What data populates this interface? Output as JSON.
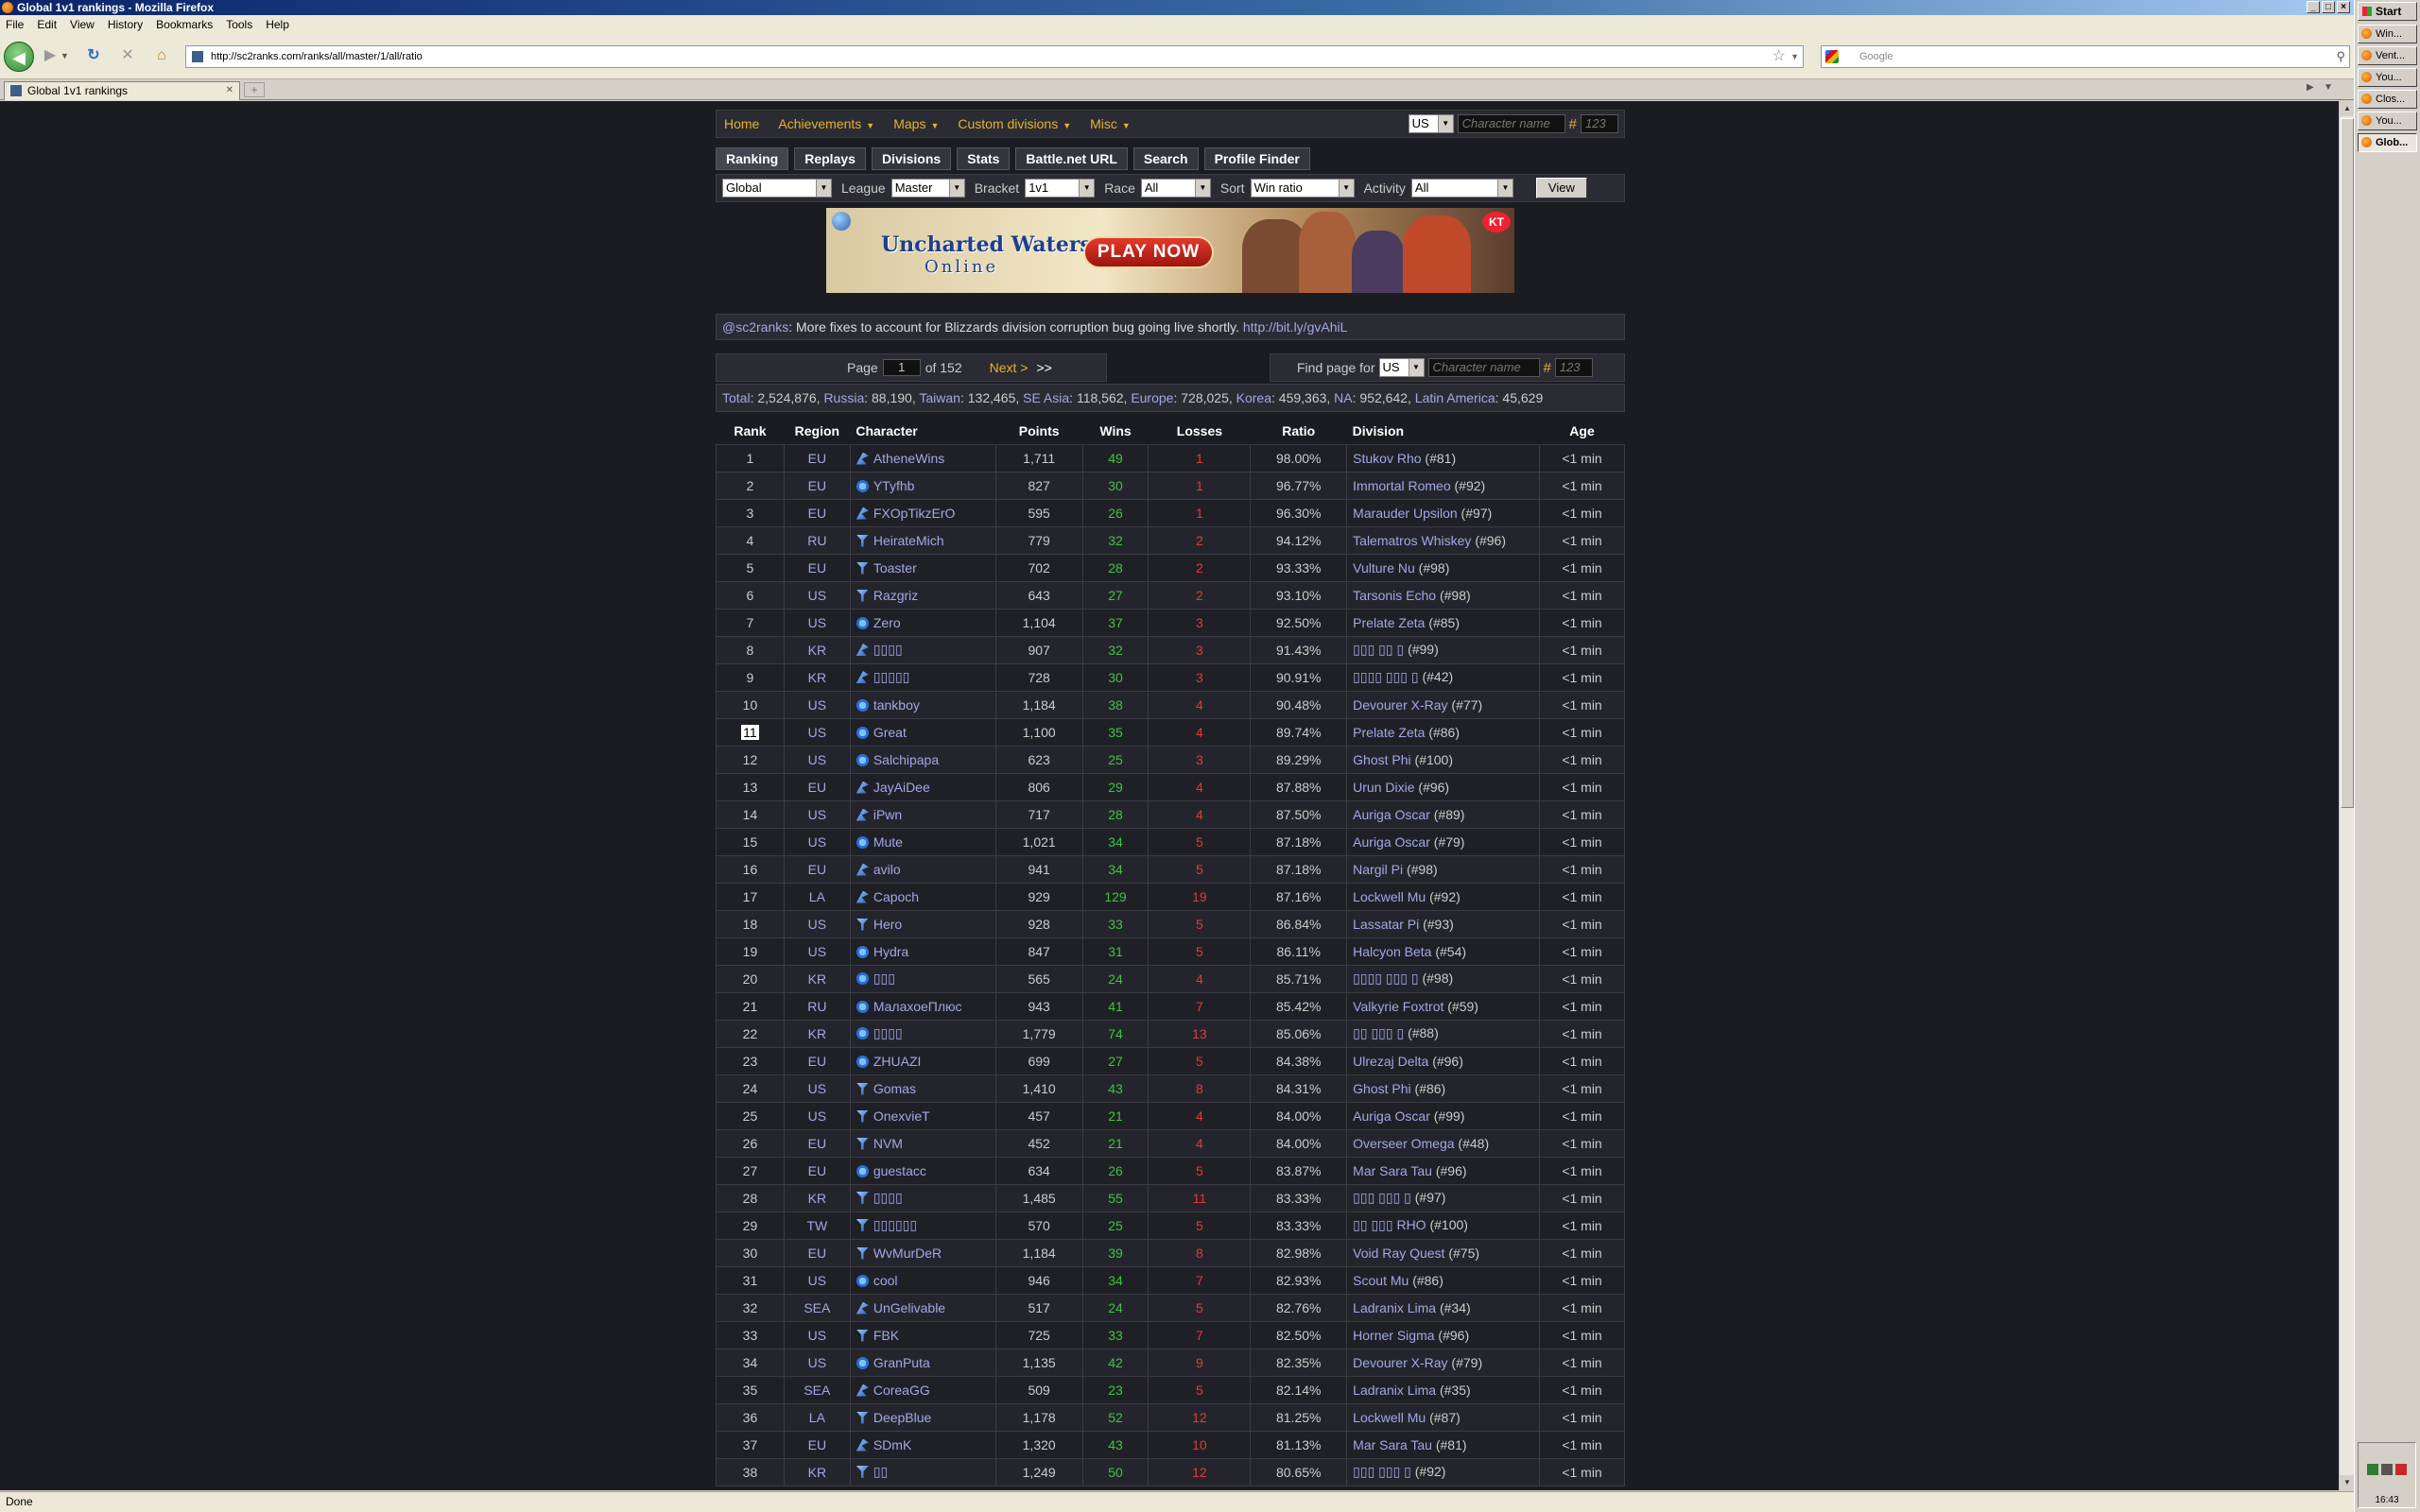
{
  "window": {
    "title": "Global 1v1 rankings - Mozilla Firefox",
    "menu": [
      "File",
      "Edit",
      "View",
      "History",
      "Bookmarks",
      "Tools",
      "Help"
    ],
    "url": "http://sc2ranks.com/ranks/all/master/1/all/ratio",
    "search_placeholder": "Google",
    "tab_title": "Global 1v1 rankings",
    "status": "Done"
  },
  "taskbar": {
    "start": "Start",
    "items": [
      "Win...",
      "Vent...",
      "You...",
      "Clos...",
      "You...",
      "Glob..."
    ],
    "clock": "16:43"
  },
  "nav": {
    "items": [
      {
        "label": "Home",
        "dropdown": false
      },
      {
        "label": "Achievements",
        "dropdown": true
      },
      {
        "label": "Maps",
        "dropdown": true
      },
      {
        "label": "Custom divisions",
        "dropdown": true
      },
      {
        "label": "Misc",
        "dropdown": true
      }
    ],
    "region": "US",
    "char_placeholder": "Character name",
    "code_placeholder": "123"
  },
  "tabs": [
    "Ranking",
    "Replays",
    "Divisions",
    "Stats",
    "Battle.net URL",
    "Search",
    "Profile Finder"
  ],
  "filters": {
    "region": "Global",
    "league_label": "League",
    "league": "Master",
    "bracket_label": "Bracket",
    "bracket": "1v1",
    "race_label": "Race",
    "race": "All",
    "sort_label": "Sort",
    "sort": "Win ratio",
    "activity_label": "Activity",
    "activity": "All",
    "view_button": "View"
  },
  "banner": {
    "title_line1": "Uncharted Waters",
    "title_line2": "Online",
    "cta": "PLAY NOW",
    "badge": "KT"
  },
  "news": {
    "handle": "@sc2ranks",
    "text": ": More fixes to account for Blizzards division corruption bug going live shortly.",
    "link": "http://bit.ly/gvAhiL"
  },
  "pager": {
    "page_label": "Page",
    "page": "1",
    "of_label": "of 152",
    "next": "Next >",
    "last": ">>",
    "find_label": "Find page for",
    "find_region": "US",
    "char_placeholder": "Character name",
    "code_placeholder": "123"
  },
  "totals": [
    {
      "label": "Total",
      "value": "2,524,876"
    },
    {
      "label": "Russia",
      "value": "88,190"
    },
    {
      "label": "Taiwan",
      "value": "132,465"
    },
    {
      "label": "SE Asia",
      "value": "118,562"
    },
    {
      "label": "Europe",
      "value": "728,025"
    },
    {
      "label": "Korea",
      "value": "459,363"
    },
    {
      "label": "NA",
      "value": "952,642"
    },
    {
      "label": "Latin America",
      "value": "45,629"
    }
  ],
  "table": {
    "headers": [
      "Rank",
      "Region",
      "Character",
      "Points",
      "Wins",
      "Losses",
      "Ratio",
      "Division",
      "Age"
    ],
    "rows": [
      {
        "rank": "1",
        "region": "EU",
        "race": "z",
        "name": "AtheneWins",
        "points": "1,711",
        "wins": "49",
        "losses": "1",
        "ratio": "98.00%",
        "division": "Stukov Rho",
        "div_num": "(#81)",
        "age": "<1 min"
      },
      {
        "rank": "2",
        "region": "EU",
        "race": "p",
        "name": "YTyfhb",
        "points": "827",
        "wins": "30",
        "losses": "1",
        "ratio": "96.77%",
        "division": "Immortal Romeo",
        "div_num": "(#92)",
        "age": "<1 min"
      },
      {
        "rank": "3",
        "region": "EU",
        "race": "z",
        "name": "FXOpTikzErO",
        "points": "595",
        "wins": "26",
        "losses": "1",
        "ratio": "96.30%",
        "division": "Marauder Upsilon",
        "div_num": "(#97)",
        "age": "<1 min"
      },
      {
        "rank": "4",
        "region": "RU",
        "race": "t",
        "name": "HeirateMich",
        "points": "779",
        "wins": "32",
        "losses": "2",
        "ratio": "94.12%",
        "division": "Talematros Whiskey",
        "div_num": "(#96)",
        "age": "<1 min"
      },
      {
        "rank": "5",
        "region": "EU",
        "race": "t",
        "name": "Toaster",
        "points": "702",
        "wins": "28",
        "losses": "2",
        "ratio": "93.33%",
        "division": "Vulture Nu",
        "div_num": "(#98)",
        "age": "<1 min"
      },
      {
        "rank": "6",
        "region": "US",
        "race": "t",
        "name": "Razgriz",
        "points": "643",
        "wins": "27",
        "losses": "2",
        "ratio": "93.10%",
        "division": "Tarsonis Echo",
        "div_num": "(#98)",
        "age": "<1 min"
      },
      {
        "rank": "7",
        "region": "US",
        "race": "p",
        "name": "Zero",
        "points": "1,104",
        "wins": "37",
        "losses": "3",
        "ratio": "92.50%",
        "division": "Prelate Zeta",
        "div_num": "(#85)",
        "age": "<1 min"
      },
      {
        "rank": "8",
        "region": "KR",
        "race": "z",
        "name": "▯▯▯▯",
        "points": "907",
        "wins": "32",
        "losses": "3",
        "ratio": "91.43%",
        "division": "▯▯▯ ▯▯ ▯",
        "div_num": "(#99)",
        "age": "<1 min"
      },
      {
        "rank": "9",
        "region": "KR",
        "race": "z",
        "name": "▯▯▯▯▯",
        "points": "728",
        "wins": "30",
        "losses": "3",
        "ratio": "90.91%",
        "division": "▯▯▯▯ ▯▯▯ ▯",
        "div_num": "(#42)",
        "age": "<1 min"
      },
      {
        "rank": "10",
        "region": "US",
        "race": "p",
        "name": "tankboy",
        "points": "1,184",
        "wins": "38",
        "losses": "4",
        "ratio": "90.48%",
        "division": "Devourer X-Ray",
        "div_num": "(#77)",
        "age": "<1 min"
      },
      {
        "rank": "11",
        "region": "US",
        "race": "p",
        "name": "Great",
        "points": "1,100",
        "wins": "35",
        "losses": "4",
        "ratio": "89.74%",
        "division": "Prelate Zeta",
        "div_num": "(#86)",
        "age": "<1 min"
      },
      {
        "rank": "12",
        "region": "US",
        "race": "p",
        "name": "Salchipapa",
        "points": "623",
        "wins": "25",
        "losses": "3",
        "ratio": "89.29%",
        "division": "Ghost Phi",
        "div_num": "(#100)",
        "age": "<1 min"
      },
      {
        "rank": "13",
        "region": "EU",
        "race": "z",
        "name": "JayAiDee",
        "points": "806",
        "wins": "29",
        "losses": "4",
        "ratio": "87.88%",
        "division": "Urun Dixie",
        "div_num": "(#96)",
        "age": "<1 min"
      },
      {
        "rank": "14",
        "region": "US",
        "race": "z",
        "name": "iPwn",
        "points": "717",
        "wins": "28",
        "losses": "4",
        "ratio": "87.50%",
        "division": "Auriga Oscar",
        "div_num": "(#89)",
        "age": "<1 min"
      },
      {
        "rank": "15",
        "region": "US",
        "race": "p",
        "name": "Mute",
        "points": "1,021",
        "wins": "34",
        "losses": "5",
        "ratio": "87.18%",
        "division": "Auriga Oscar",
        "div_num": "(#79)",
        "age": "<1 min"
      },
      {
        "rank": "16",
        "region": "EU",
        "race": "z",
        "name": "avilo",
        "points": "941",
        "wins": "34",
        "losses": "5",
        "ratio": "87.18%",
        "division": "Nargil Pi",
        "div_num": "(#98)",
        "age": "<1 min"
      },
      {
        "rank": "17",
        "region": "LA",
        "race": "z",
        "name": "Capoch",
        "points": "929",
        "wins": "129",
        "losses": "19",
        "ratio": "87.16%",
        "division": "Lockwell Mu",
        "div_num": "(#92)",
        "age": "<1 min"
      },
      {
        "rank": "18",
        "region": "US",
        "race": "t",
        "name": "Hero",
        "points": "928",
        "wins": "33",
        "losses": "5",
        "ratio": "86.84%",
        "division": "Lassatar Pi",
        "div_num": "(#93)",
        "age": "<1 min"
      },
      {
        "rank": "19",
        "region": "US",
        "race": "p",
        "name": "Hydra",
        "points": "847",
        "wins": "31",
        "losses": "5",
        "ratio": "86.11%",
        "division": "Halcyon Beta",
        "div_num": "(#54)",
        "age": "<1 min"
      },
      {
        "rank": "20",
        "region": "KR",
        "race": "p",
        "name": "▯▯▯",
        "points": "565",
        "wins": "24",
        "losses": "4",
        "ratio": "85.71%",
        "division": "▯▯▯▯ ▯▯▯ ▯",
        "div_num": "(#98)",
        "age": "<1 min"
      },
      {
        "rank": "21",
        "region": "RU",
        "race": "p",
        "name": "МалахоеПлюс",
        "points": "943",
        "wins": "41",
        "losses": "7",
        "ratio": "85.42%",
        "division": "Valkyrie Foxtrot",
        "div_num": "(#59)",
        "age": "<1 min"
      },
      {
        "rank": "22",
        "region": "KR",
        "race": "p",
        "name": "▯▯▯▯",
        "points": "1,779",
        "wins": "74",
        "losses": "13",
        "ratio": "85.06%",
        "division": "▯▯ ▯▯▯ ▯",
        "div_num": "(#88)",
        "age": "<1 min"
      },
      {
        "rank": "23",
        "region": "EU",
        "race": "p",
        "name": "ZHUAZI",
        "points": "699",
        "wins": "27",
        "losses": "5",
        "ratio": "84.38%",
        "division": "Ulrezaj Delta",
        "div_num": "(#96)",
        "age": "<1 min"
      },
      {
        "rank": "24",
        "region": "US",
        "race": "t",
        "name": "Gomas",
        "points": "1,410",
        "wins": "43",
        "losses": "8",
        "ratio": "84.31%",
        "division": "Ghost Phi",
        "div_num": "(#86)",
        "age": "<1 min"
      },
      {
        "rank": "25",
        "region": "US",
        "race": "t",
        "name": "OnexvieT",
        "points": "457",
        "wins": "21",
        "losses": "4",
        "ratio": "84.00%",
        "division": "Auriga Oscar",
        "div_num": "(#99)",
        "age": "<1 min"
      },
      {
        "rank": "26",
        "region": "EU",
        "race": "t",
        "name": "NVM",
        "points": "452",
        "wins": "21",
        "losses": "4",
        "ratio": "84.00%",
        "division": "Overseer Omega",
        "div_num": "(#48)",
        "age": "<1 min"
      },
      {
        "rank": "27",
        "region": "EU",
        "race": "p",
        "name": "guestacc",
        "points": "634",
        "wins": "26",
        "losses": "5",
        "ratio": "83.87%",
        "division": "Mar Sara Tau",
        "div_num": "(#96)",
        "age": "<1 min"
      },
      {
        "rank": "28",
        "region": "KR",
        "race": "t",
        "name": "▯▯▯▯",
        "points": "1,485",
        "wins": "55",
        "losses": "11",
        "ratio": "83.33%",
        "division": "▯▯▯ ▯▯▯ ▯",
        "div_num": "(#97)",
        "age": "<1 min"
      },
      {
        "rank": "29",
        "region": "TW",
        "race": "t",
        "name": "▯▯▯▯▯▯",
        "points": "570",
        "wins": "25",
        "losses": "5",
        "ratio": "83.33%",
        "division": "▯▯ ▯▯▯ RHO",
        "div_num": "(#100)",
        "age": "<1 min"
      },
      {
        "rank": "30",
        "region": "EU",
        "race": "t",
        "name": "WvMurDeR",
        "points": "1,184",
        "wins": "39",
        "losses": "8",
        "ratio": "82.98%",
        "division": "Void Ray Quest",
        "div_num": "(#75)",
        "age": "<1 min"
      },
      {
        "rank": "31",
        "region": "US",
        "race": "p",
        "name": "cool",
        "points": "946",
        "wins": "34",
        "losses": "7",
        "ratio": "82.93%",
        "division": "Scout Mu",
        "div_num": "(#86)",
        "age": "<1 min"
      },
      {
        "rank": "32",
        "region": "SEA",
        "race": "z",
        "name": "UnGelivable",
        "points": "517",
        "wins": "24",
        "losses": "5",
        "ratio": "82.76%",
        "division": "Ladranix Lima",
        "div_num": "(#34)",
        "age": "<1 min"
      },
      {
        "rank": "33",
        "region": "US",
        "race": "t",
        "name": "FBK",
        "points": "725",
        "wins": "33",
        "losses": "7",
        "ratio": "82.50%",
        "division": "Horner Sigma",
        "div_num": "(#96)",
        "age": "<1 min"
      },
      {
        "rank": "34",
        "region": "US",
        "race": "p",
        "name": "GranPuta",
        "points": "1,135",
        "wins": "42",
        "losses": "9",
        "ratio": "82.35%",
        "division": "Devourer X-Ray",
        "div_num": "(#79)",
        "age": "<1 min"
      },
      {
        "rank": "35",
        "region": "SEA",
        "race": "z",
        "name": "CoreaGG",
        "points": "509",
        "wins": "23",
        "losses": "5",
        "ratio": "82.14%",
        "division": "Ladranix Lima",
        "div_num": "(#35)",
        "age": "<1 min"
      },
      {
        "rank": "36",
        "region": "LA",
        "race": "t",
        "name": "DeepBlue",
        "points": "1,178",
        "wins": "52",
        "losses": "12",
        "ratio": "81.25%",
        "division": "Lockwell Mu",
        "div_num": "(#87)",
        "age": "<1 min"
      },
      {
        "rank": "37",
        "region": "EU",
        "race": "z",
        "name": "SDmK",
        "points": "1,320",
        "wins": "43",
        "losses": "10",
        "ratio": "81.13%",
        "division": "Mar Sara Tau",
        "div_num": "(#81)",
        "age": "<1 min"
      },
      {
        "rank": "38",
        "region": "KR",
        "race": "t",
        "name": "▯▯",
        "points": "1,249",
        "wins": "50",
        "losses": "12",
        "ratio": "80.65%",
        "division": "▯▯▯ ▯▯▯ ▯",
        "div_num": "(#92)",
        "age": "<1 min"
      }
    ],
    "selected_rank": "11"
  }
}
